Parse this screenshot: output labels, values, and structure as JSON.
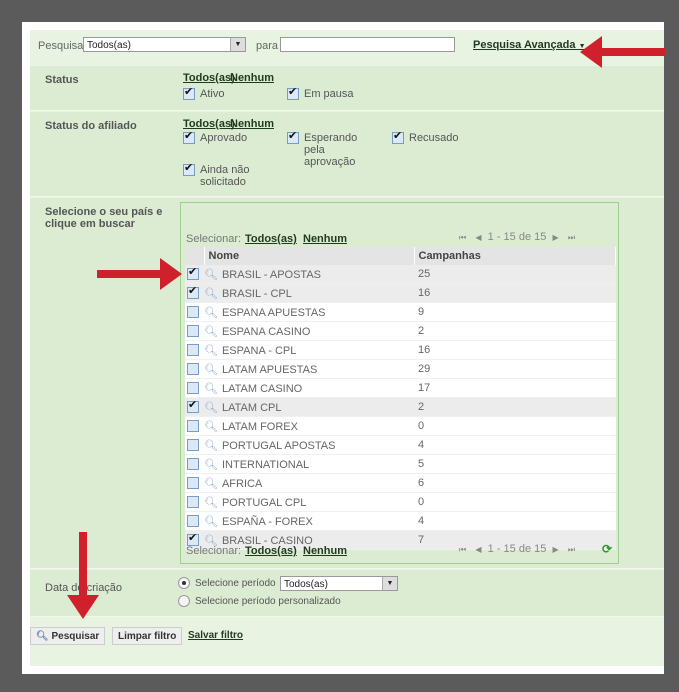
{
  "search": {
    "label": "Pesquisar em",
    "scope": "Todos(as)",
    "para": "para",
    "query": "",
    "advanced": "Pesquisa Avançada"
  },
  "status": {
    "label": "Status",
    "all": "Todos(as)",
    "none": "Nenhum",
    "options": [
      {
        "label": "Ativo",
        "checked": true
      },
      {
        "label": "Em pausa",
        "checked": true
      }
    ]
  },
  "affiliate_status": {
    "label": "Status do afiliado",
    "all": "Todos(as)",
    "none": "Nenhum",
    "options": [
      {
        "label": "Aprovado",
        "checked": true
      },
      {
        "label": "Esperando pela aprovação",
        "checked": true
      },
      {
        "label": "Recusado",
        "checked": true
      },
      {
        "label": "Ainda não solicitado",
        "checked": true
      }
    ]
  },
  "country": {
    "label": "Selecione o seu país e clique em buscar",
    "select_label": "Selecionar:",
    "all": "Todos(as)",
    "none": "Nenhum",
    "pager": "1 - 15 de 15",
    "columns": [
      "Nome",
      "Campanhas"
    ],
    "rows": [
      {
        "name": "BRASIL - APOSTAS",
        "count": "25",
        "checked": true
      },
      {
        "name": "BRASIL - CPL",
        "count": "16",
        "checked": true
      },
      {
        "name": "ESPANA APUESTAS",
        "count": "9",
        "checked": false
      },
      {
        "name": "ESPANA CASINO",
        "count": "2",
        "checked": false
      },
      {
        "name": "ESPANA - CPL",
        "count": "16",
        "checked": false
      },
      {
        "name": "LATAM APUESTAS",
        "count": "29",
        "checked": false
      },
      {
        "name": "LATAM CASINO",
        "count": "17",
        "checked": false
      },
      {
        "name": "LATAM CPL",
        "count": "2",
        "checked": true
      },
      {
        "name": "LATAM FOREX",
        "count": "0",
        "checked": false
      },
      {
        "name": "PORTUGAL APOSTAS",
        "count": "4",
        "checked": false
      },
      {
        "name": "INTERNATIONAL",
        "count": "5",
        "checked": false
      },
      {
        "name": "AFRICA",
        "count": "6",
        "checked": false
      },
      {
        "name": "PORTUGAL CPL",
        "count": "0",
        "checked": false
      },
      {
        "name": "ESPAÑA - FOREX",
        "count": "4",
        "checked": false
      },
      {
        "name": "BRASIL - CASINO",
        "count": "7",
        "checked": true
      }
    ]
  },
  "date": {
    "label": "Data de criação",
    "option1": "Selecione período",
    "period": "Todos(as)",
    "option2": "Selecione período personalizado"
  },
  "buttons": {
    "search": "Pesquisar",
    "clear": "Limpar filtro",
    "save": "Salvar filtro"
  },
  "colors": {
    "annotation_arrow": "#d0202b",
    "section_bg": "#dcecd3"
  }
}
